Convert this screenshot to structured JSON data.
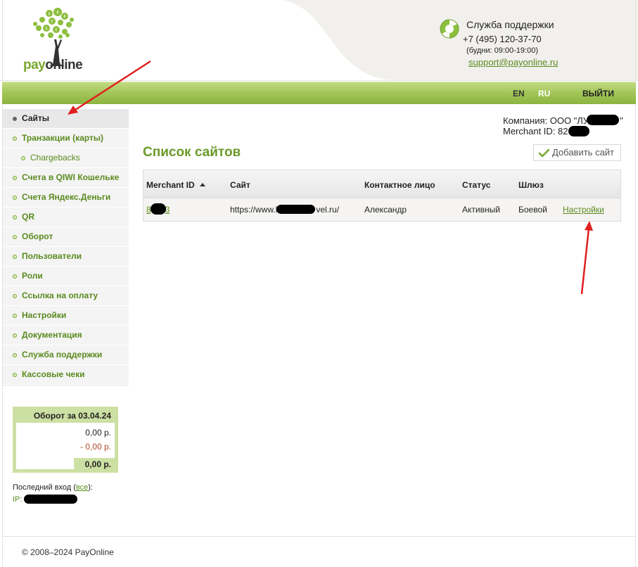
{
  "brand": {
    "logo_pay": "pay",
    "logo_online": "online",
    "accent_color": "#8cb440",
    "link_color": "#5a8a1e"
  },
  "support": {
    "title": "Служба поддержки",
    "phone": "+7 (495) 120-37-70",
    "hours": "(будни: 09:00-19:00)",
    "email": "support@payonline.ru"
  },
  "topbar": {
    "lang_en": "EN",
    "lang_ru": "RU",
    "logout": "ВЫЙТИ"
  },
  "sidebar": {
    "items": [
      {
        "label": "Сайты",
        "active": true
      },
      {
        "label": "Транзакции (карты)"
      },
      {
        "label": "Chargebacks",
        "sub": true
      },
      {
        "label": "Счета в QIWI Кошельке"
      },
      {
        "label": "Счета Яндекс.Деньги"
      },
      {
        "label": "QR"
      },
      {
        "label": "Оборот"
      },
      {
        "label": "Пользователи"
      },
      {
        "label": "Роли"
      },
      {
        "label": "Ссылка на оплату"
      },
      {
        "label": "Настройки"
      },
      {
        "label": "Документация"
      },
      {
        "label": "Служба поддержки"
      },
      {
        "label": "Кассовые чеки"
      }
    ]
  },
  "turnover": {
    "title": "Оборот за 03.04.24",
    "value": "0,00 р.",
    "refunds": "- 0,00 р.",
    "total": "0,00 р."
  },
  "last_login": {
    "label": "Последний вход (",
    "all_link": "все",
    "label_end": "):",
    "ip_prefix": "IP: 8"
  },
  "company": {
    "company_line": "Компания: ООО \"ЛУ",
    "company_end": "\"",
    "merchant_line": "Merchant ID: 82"
  },
  "main": {
    "title": "Список сайтов",
    "add_button": "Добавить сайт"
  },
  "table": {
    "headers": [
      "Merchant ID",
      "Сайт",
      "Контактное лицо",
      "Статус",
      "Шлюз"
    ],
    "rows": [
      {
        "merchant_id": "8",
        "merchant_id_end": "3",
        "site_start": "https://www.l",
        "site_end": "vel.ru/",
        "contact": "Александр",
        "status": "Активный",
        "gateway": "Боевой",
        "action": "Настройки"
      }
    ]
  },
  "footer": {
    "copyright": "© 2008–2024 PayOnline"
  }
}
